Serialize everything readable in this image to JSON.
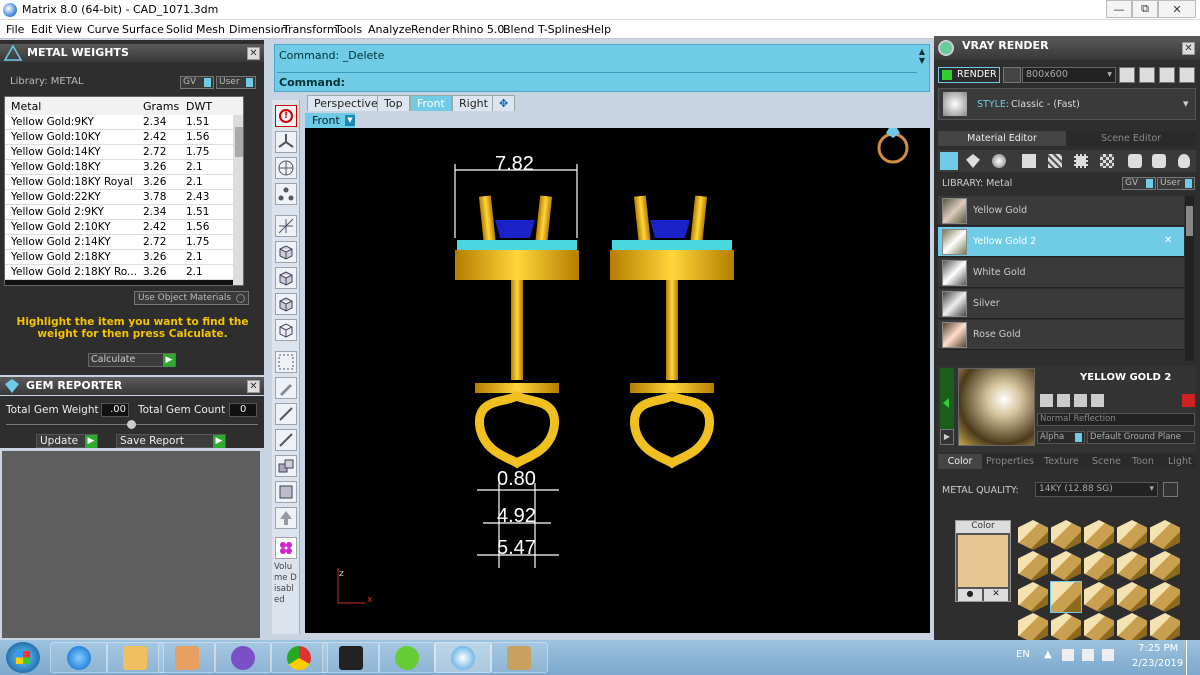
{
  "window": {
    "title": "Matrix 8.0 (64-bit) - CAD_1071.3dm",
    "minimize": "—",
    "restore": "⧉",
    "close": "✕"
  },
  "menu": [
    "File",
    "Edit",
    "View",
    "Curve",
    "Surface",
    "Solid",
    "Mesh",
    "Dimension",
    "Transform",
    "Tools",
    "Analyze",
    "Render",
    "Rhino 5.0",
    "Blend",
    "T-Splines",
    "Help"
  ],
  "metal_weights": {
    "title": "METAL WEIGHTS",
    "library_label": "Library: METAL",
    "gv": "GV",
    "user": "User",
    "columns": [
      "Metal",
      "Grams",
      "DWT"
    ],
    "rows": [
      [
        "Yellow Gold:9KY",
        "2.34",
        "1.51"
      ],
      [
        "Yellow Gold:10KY",
        "2.42",
        "1.56"
      ],
      [
        "Yellow Gold:14KY",
        "2.72",
        "1.75"
      ],
      [
        "Yellow Gold:18KY",
        "3.26",
        "2.1"
      ],
      [
        "Yellow Gold:18KY Royal",
        "3.26",
        "2.1"
      ],
      [
        "Yellow Gold:22KY",
        "3.78",
        "2.43"
      ],
      [
        "Yellow Gold 2:9KY",
        "2.34",
        "1.51"
      ],
      [
        "Yellow Gold 2:10KY",
        "2.42",
        "1.56"
      ],
      [
        "Yellow Gold 2:14KY",
        "2.72",
        "1.75"
      ],
      [
        "Yellow Gold 2:18KY",
        "3.26",
        "2.1"
      ],
      [
        "Yellow Gold 2:18KY Ro...",
        "3.26",
        "2.1"
      ]
    ],
    "use_object_materials": "Use Object Materials",
    "hint": "Highlight the item you want to find the weight for then press Calculate.",
    "calculate": "Calculate"
  },
  "gem_reporter": {
    "title": "GEM REPORTER",
    "total_weight_label": "Total Gem Weight",
    "total_weight_value": ".00",
    "total_count_label": "Total Gem Count",
    "total_count_value": "0",
    "update": "Update",
    "save_report": "Save Report"
  },
  "command": {
    "line1": "Command: _Delete",
    "line2": "Command:"
  },
  "view_tabs": [
    "Perspective",
    "Top",
    "Front",
    "Right",
    "✥"
  ],
  "active_view": "Front",
  "viewport_label": "Front",
  "dimensions": [
    "7.82",
    "0.80",
    "4.92",
    "5.47"
  ],
  "axis": {
    "z": "z",
    "x": "x"
  },
  "volume_disabled": "Volume Disabled",
  "vray": {
    "title": "VRAY RENDER",
    "render": "RENDER",
    "resolution": "800x600",
    "style_label": "STYLE:",
    "style_value": "Classic - (Fast)",
    "tabs": [
      "Material Editor",
      "Scene Editor"
    ],
    "library": "LIBRARY: Metal",
    "gv": "GV",
    "user": "User",
    "materials": [
      "Yellow Gold",
      "Yellow Gold 2",
      "White Gold",
      "Silver",
      "Rose Gold"
    ],
    "selected_material": "YELLOW GOLD 2",
    "reflection": "Normal Reflection",
    "alpha": "Alpha",
    "ground_plane": "Default Ground Plane",
    "subtabs": [
      "Color",
      "Properties",
      "Texture",
      "Scene",
      "Toon",
      "Light"
    ],
    "metal_quality_label": "METAL QUALITY:",
    "metal_quality_value": "14KY  (12.88 SG)",
    "color_label": "Color"
  },
  "taskbar": {
    "lang": "EN",
    "time": "7:25 PM",
    "date": "2/23/2019"
  },
  "colors": {
    "accent": "#6fcbe6",
    "gold": "#e8b416",
    "panel": "#2e2e2e"
  }
}
